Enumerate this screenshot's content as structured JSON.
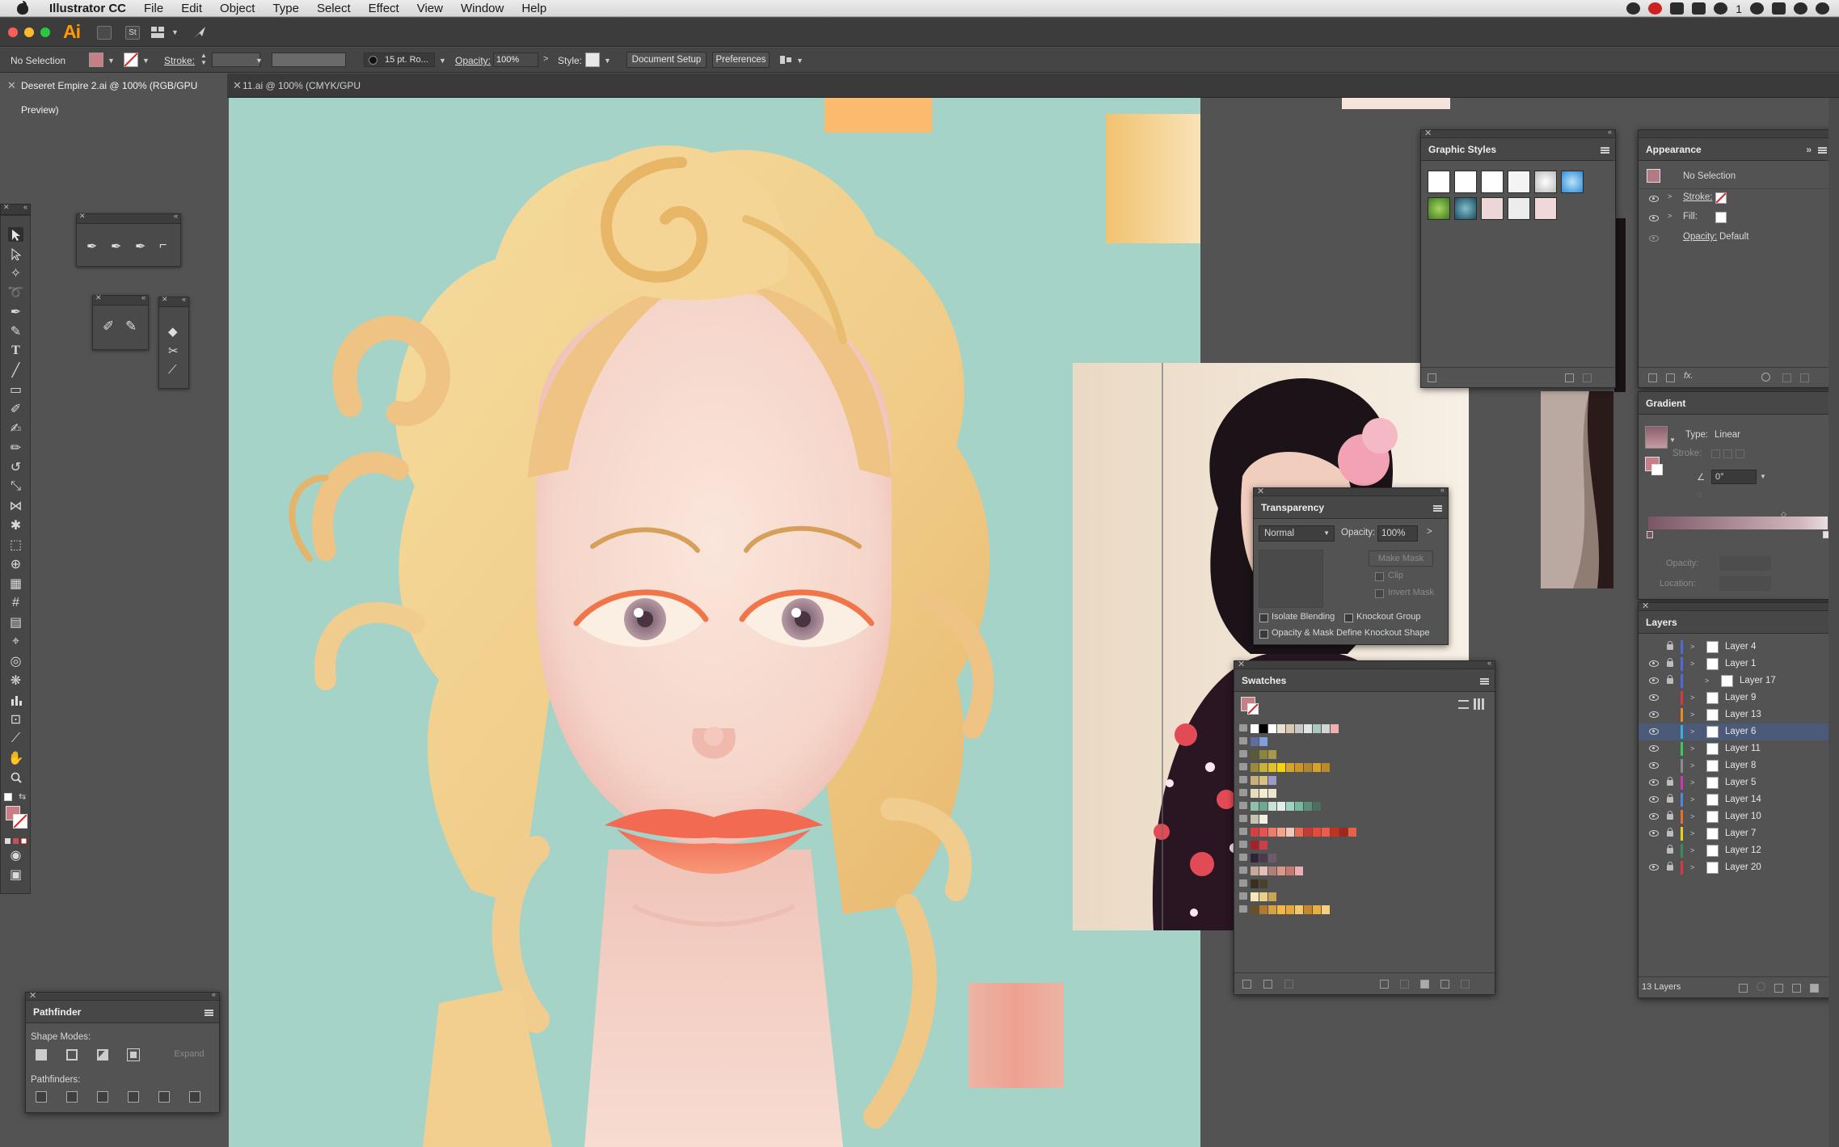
{
  "menubar": {
    "app_name": "Illustrator CC",
    "items": [
      "File",
      "Edit",
      "Object",
      "Type",
      "Select",
      "Effect",
      "View",
      "Window",
      "Help"
    ],
    "status_count": "1"
  },
  "appbar": {
    "logo": "Ai",
    "st_label": "St"
  },
  "control_bar": {
    "selection": "No Selection",
    "stroke_label": "Stroke:",
    "brush": "15 pt. Ro...",
    "opacity_label": "Opacity:",
    "opacity_value": "100%",
    "style_label": "Style:",
    "document_setup": "Document Setup",
    "preferences": "Preferences"
  },
  "tabs": [
    {
      "label": "Deseret Empire 2.ai @ 100% (RGB/GPU Preview)"
    },
    {
      "label": "11.ai @ 100% (CMYK/GPU Preview)"
    }
  ],
  "graphic_styles": {
    "title": "Graphic Styles"
  },
  "appearance": {
    "title": "Appearance",
    "selection": "No Selection",
    "stroke_label": "Stroke:",
    "fill_label": "Fill:",
    "opacity_label": "Opacity:",
    "opacity_value": "Default"
  },
  "gradient": {
    "title": "Gradient",
    "type_label": "Type:",
    "type_value": "Linear",
    "stroke_label": "Stroke:",
    "angle_value": "0°",
    "opacity_label": "Opacity:",
    "location_label": "Location:"
  },
  "transparency": {
    "title": "Transparency",
    "blend_mode": "Normal",
    "opacity_label": "Opacity:",
    "opacity_value": "100%",
    "make_mask": "Make Mask",
    "clip": "Clip",
    "invert_mask": "Invert Mask",
    "isolate_blending": "Isolate Blending",
    "knockout_group": "Knockout Group",
    "opacity_mask": "Opacity & Mask Define Knockout Shape"
  },
  "swatches": {
    "title": "Swatches",
    "rows": [
      [
        "#ffffff",
        "#000000",
        "#ffffff",
        "#e8e0d0",
        "#d9c8b0",
        "#c8c8c8",
        "#e0e6e2",
        "#a9c9bf",
        "#cfd8d4",
        "#f0b0b0"
      ],
      [
        "#5f6f9c",
        "#7fa0d8"
      ],
      [
        "#5a5a34",
        "#8c8340",
        "#a69a4a"
      ],
      [
        "#9a8b3a",
        "#c7b23c",
        "#e2c12a",
        "#f2d411",
        "#d9a22a",
        "#c8962c",
        "#b4872e",
        "#d8a12a",
        "#ba8a26"
      ],
      [
        "#c8b07a",
        "#d8c083",
        "#9b9bc6"
      ],
      [
        "#e8dcbe",
        "#f4ebd2",
        "#efe6cf"
      ],
      [
        "#8cc3a8",
        "#6ea88d",
        "#c8e2d4",
        "#e3eee8",
        "#9fd2c0",
        "#7ab89d",
        "#5b8f7c",
        "#4b6e60"
      ],
      [
        "#c6c3b4",
        "#f2efe3"
      ],
      [
        "#d64040",
        "#e55353",
        "#f27a6a",
        "#f4a488",
        "#f0c8b8",
        "#e86a54",
        "#c83a2e",
        "#e84a3a",
        "#f05a48",
        "#c8301e",
        "#a82418",
        "#e8604a"
      ],
      [
        "#a8202a",
        "#c84048"
      ],
      [
        "#2e2636",
        "#4a3a4e",
        "#6e5a6a"
      ],
      [
        "#c8a898",
        "#e0c0b8",
        "#b08078",
        "#d8988c",
        "#c87870",
        "#e8b0b0"
      ],
      [
        "#3a3022",
        "#4a4030"
      ],
      [
        "#f6e6b8",
        "#e8d08a",
        "#caa454"
      ],
      [
        "#6a5028",
        "#b07830",
        "#d8a040",
        "#f0b848",
        "#e8a838",
        "#f0c870",
        "#c88828",
        "#e8b040",
        "#f8d080"
      ]
    ]
  },
  "layers": {
    "title": "Layers",
    "count": "13 Layers",
    "rows": [
      {
        "name": "Layer 4",
        "color": "#4c6bd8",
        "eye": false,
        "lock": true,
        "selected": false,
        "indent": false
      },
      {
        "name": "Layer 1",
        "color": "#4c6bd8",
        "eye": true,
        "lock": true,
        "selected": false,
        "indent": false
      },
      {
        "name": "Layer 17",
        "color": "#4c6bd8",
        "eye": true,
        "lock": true,
        "selected": false,
        "indent": true
      },
      {
        "name": "Layer 9",
        "color": "#d83a3a",
        "eye": true,
        "lock": false,
        "selected": false,
        "indent": false
      },
      {
        "name": "Layer 13",
        "color": "#e88a20",
        "eye": true,
        "lock": false,
        "selected": false,
        "indent": false
      },
      {
        "name": "Layer 6",
        "color": "#3ab0d8",
        "eye": true,
        "lock": false,
        "selected": true,
        "indent": false
      },
      {
        "name": "Layer 11",
        "color": "#3ac85a",
        "eye": true,
        "lock": false,
        "selected": false,
        "indent": false
      },
      {
        "name": "Layer 8",
        "color": "#8a8a8a",
        "eye": true,
        "lock": false,
        "selected": false,
        "indent": false
      },
      {
        "name": "Layer 5",
        "color": "#c83ab0",
        "eye": true,
        "lock": true,
        "selected": false,
        "indent": false
      },
      {
        "name": "Layer 14",
        "color": "#4a8ad8",
        "eye": true,
        "lock": true,
        "selected": false,
        "indent": false
      },
      {
        "name": "Layer 10",
        "color": "#e8702a",
        "eye": true,
        "lock": true,
        "selected": false,
        "indent": false
      },
      {
        "name": "Layer 7",
        "color": "#e8d020",
        "eye": true,
        "lock": true,
        "selected": false,
        "indent": false
      },
      {
        "name": "Layer 12",
        "color": "#3a8a5a",
        "eye": false,
        "lock": true,
        "selected": false,
        "indent": false
      },
      {
        "name": "Layer 20",
        "color": "#d83a3a",
        "eye": true,
        "lock": true,
        "selected": false,
        "indent": false
      }
    ]
  },
  "pathfinder": {
    "title": "Pathfinder",
    "shape_modes": "Shape Modes:",
    "pathfinders": "Pathfinders:",
    "expand": "Expand"
  },
  "colors": {
    "canvas_bg": "#535353",
    "artboard": "#a6d3c7",
    "hair": "#f2cf8e",
    "skin": "#f7d9cf",
    "lips": "#f4765a",
    "selected_layer": "#4a5a78",
    "ai_orange": "#ff9a00"
  }
}
